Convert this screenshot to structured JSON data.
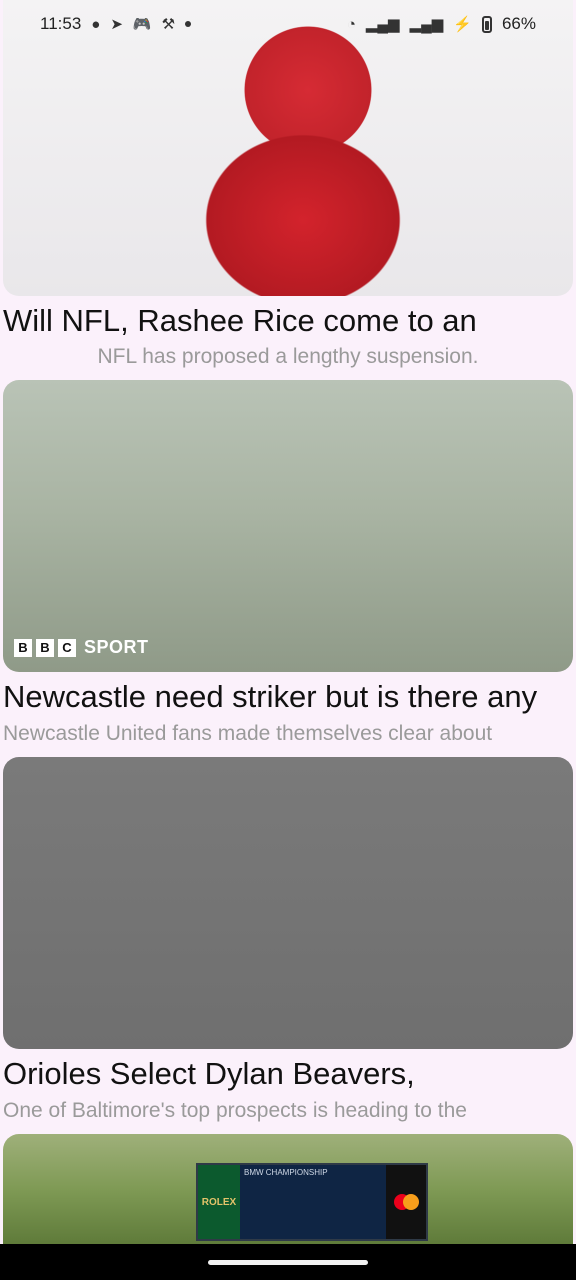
{
  "status_bar": {
    "time": "11:53",
    "battery": "66%",
    "left_icons": [
      "chat-icon",
      "send-icon",
      "gamepad-icon",
      "tools-icon",
      "dot-icon"
    ],
    "right_icons": [
      "wifi-icon",
      "signal-icon",
      "signal-icon",
      "charging-icon",
      "battery-icon"
    ]
  },
  "articles": [
    {
      "title": "Will NFL, Rashee Rice come to an",
      "description": "NFL has proposed a lengthy suspension.",
      "image": "football-player-helmet"
    },
    {
      "title": "Newcastle need striker but is there any",
      "description": "Newcastle United fans made themselves clear about",
      "image": "soccer-player-training",
      "badge": {
        "blocks": [
          "B",
          "B",
          "C"
        ],
        "label": "SPORT"
      }
    },
    {
      "title": "Orioles Select Dylan Beavers,",
      "description": "One of Baltimore's top prospects is heading to the",
      "image": "baseball-player-portrait"
    },
    {
      "image": "golf-course-scoreboard",
      "scoreboard": {
        "sponsor": "ROLEX",
        "event": "BMW CHAMPIONSHIP"
      }
    }
  ],
  "colors": {
    "background": "#fbf1fb",
    "title": "#111111",
    "description": "#9a9a9a",
    "nav_bar": "#000000"
  }
}
